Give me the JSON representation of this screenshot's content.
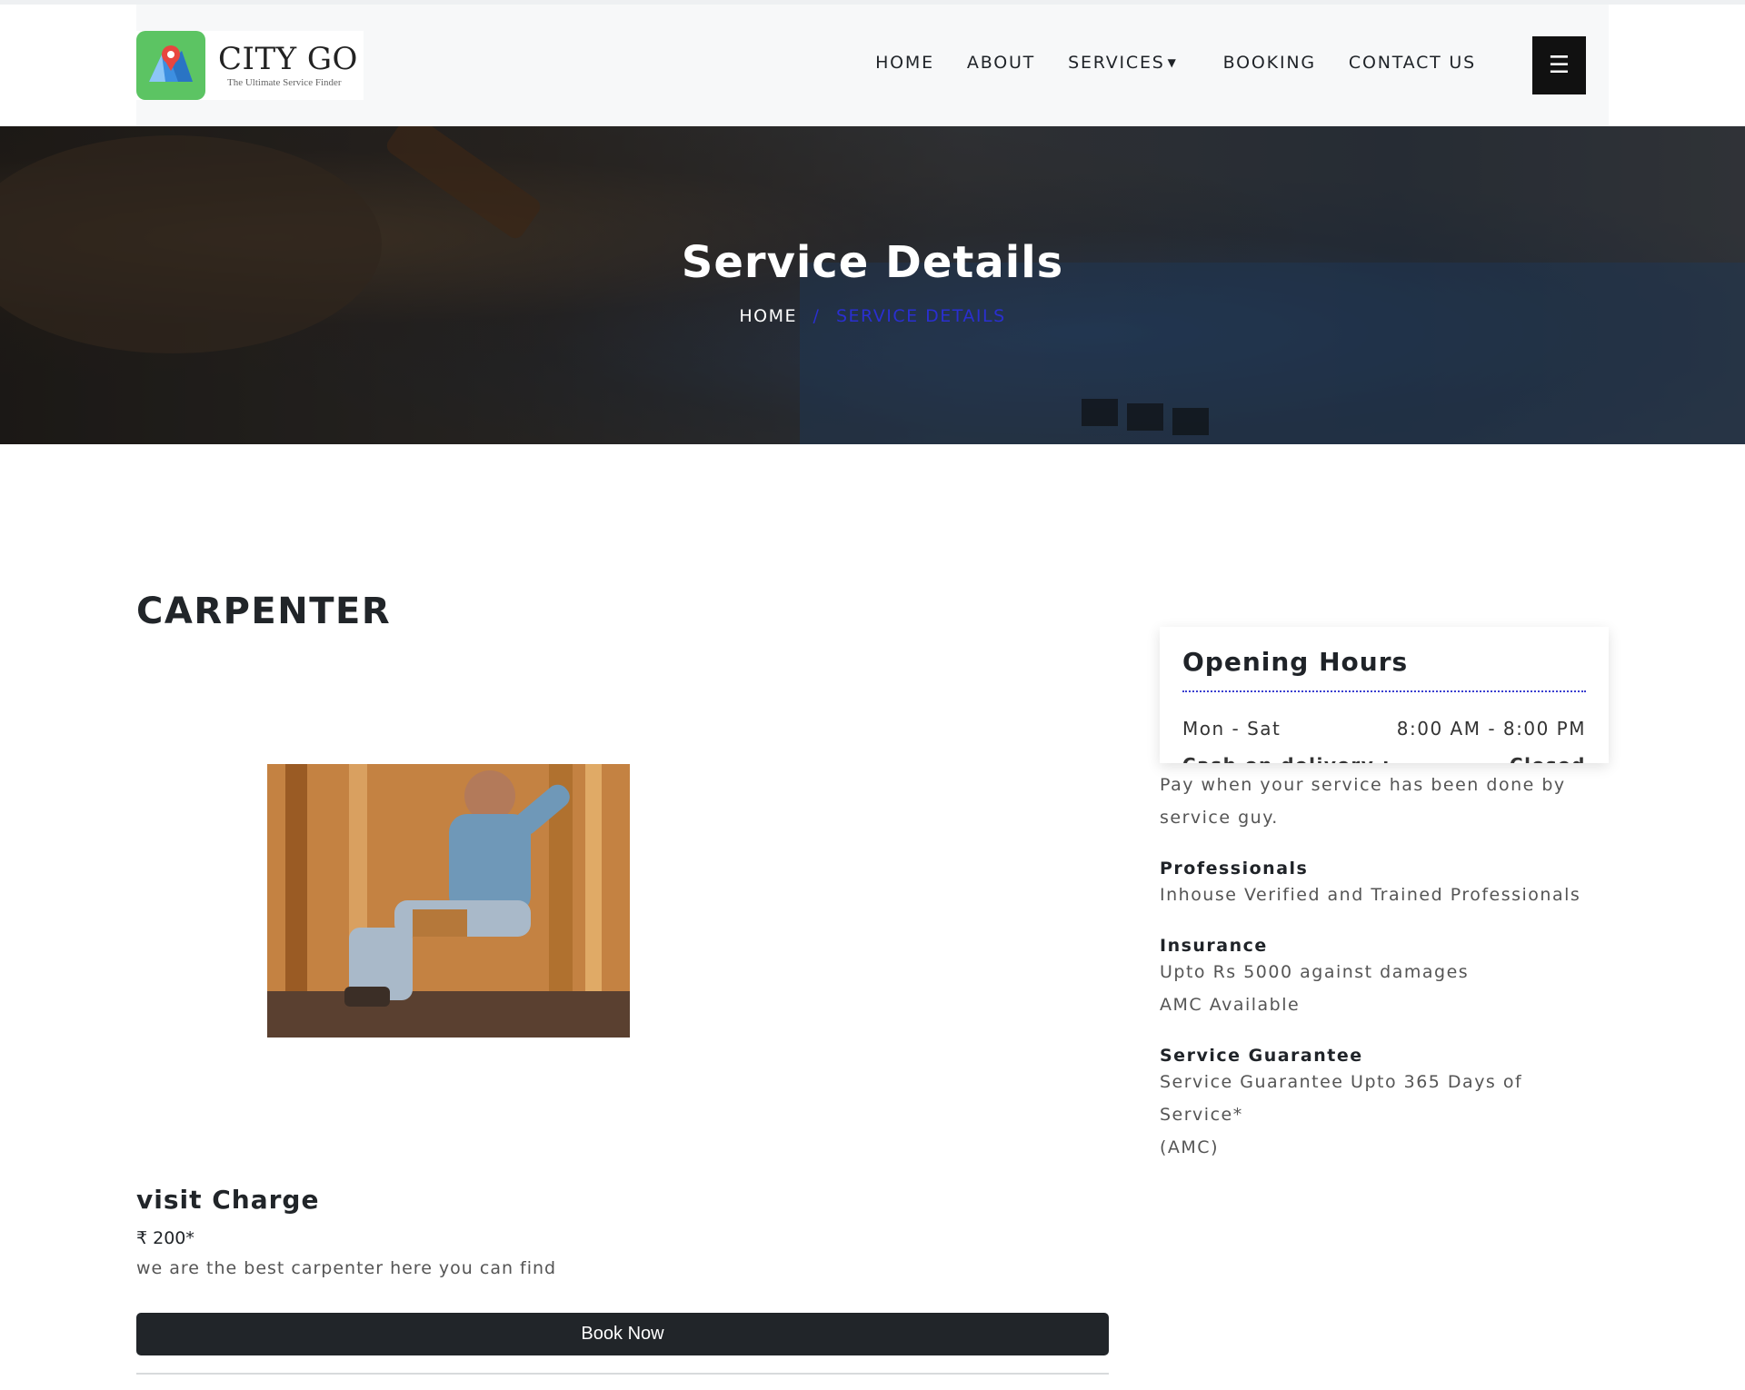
{
  "brand": {
    "name": "CITY GO",
    "tagline": "The Ultimate Service Finder"
  },
  "nav": {
    "home": "HOME",
    "about": "ABOUT",
    "services": "SERVICES",
    "booking": "BOOKING",
    "contact": "CONTACT US",
    "menu_icon": "☰"
  },
  "hero": {
    "title": "Service Details",
    "breadcrumb_home": "HOME",
    "breadcrumb_sep": "/",
    "breadcrumb_current": "SERVICE DETAILS"
  },
  "service": {
    "title": "CARPENTER",
    "image_alt": "carpenter at work",
    "visit_title": "visit Charge",
    "price": "₹ 200*",
    "description": "we are the best carpenter here you can find",
    "book_label": "Book Now"
  },
  "hours": {
    "title": "Opening Hours",
    "rows": [
      {
        "day": "Mon - Sat",
        "time": "8:00 AM - 8:00 PM"
      },
      {
        "day": "Cash on delivery :",
        "time": "Closed"
      }
    ]
  },
  "features": [
    {
      "title": "",
      "lines": [
        "Pay when your service has been done by",
        "service guy."
      ]
    },
    {
      "title": "Professionals",
      "lines": [
        "Inhouse Verified and Trained Professionals"
      ]
    },
    {
      "title": "Insurance",
      "lines": [
        "Upto Rs 5000 against damages",
        "AMC Available"
      ]
    },
    {
      "title": "Service Guarantee",
      "lines": [
        "Service Guarantee Upto 365 Days of Service*",
        "(AMC)"
      ]
    }
  ],
  "colors": {
    "accent_blue": "#2a2fd0",
    "button_dark": "#212529",
    "logo_green": "#5cc463"
  }
}
